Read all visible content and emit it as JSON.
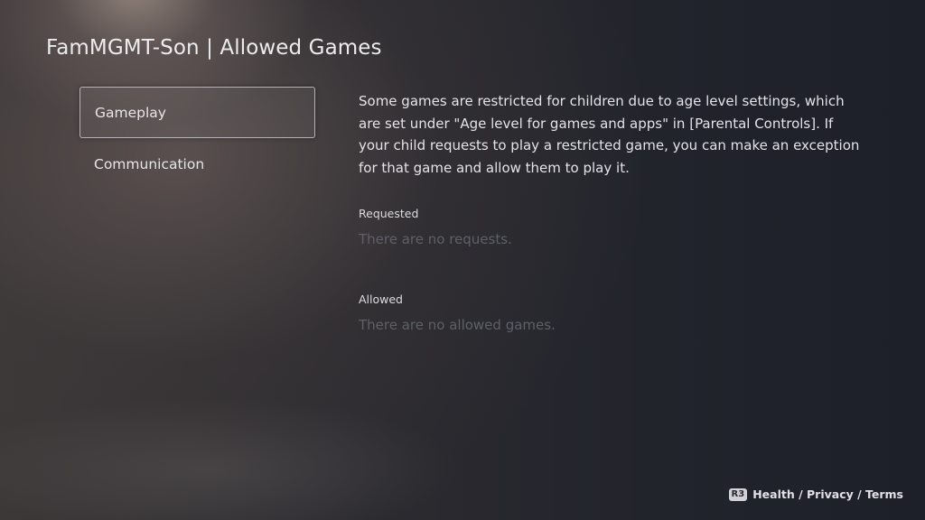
{
  "header": {
    "title": "FamMGMT-Son | Allowed Games"
  },
  "sidebar": {
    "items": [
      {
        "label": "Gameplay",
        "selected": true
      },
      {
        "label": "Communication",
        "selected": false
      }
    ]
  },
  "main": {
    "description": "Some games are restricted for children due to age level settings, which are set under \"Age level for games and apps\" in [Parental Controls]. If your child requests to play a restricted game, you can make an exception for that game and allow them to play it.",
    "requested": {
      "heading": "Requested",
      "empty_text": "There are no requests."
    },
    "allowed": {
      "heading": "Allowed",
      "empty_text": "There are no allowed games."
    }
  },
  "footer": {
    "button_glyph": "R3",
    "hint_label": "Health / Privacy / Terms"
  },
  "colors": {
    "background": "#22242c",
    "text_primary": "#e8e8ea",
    "text_disabled": "#5d6068",
    "selection_border": "#cdcdd4"
  },
  "icons": {
    "footer_button": "r3-button-icon"
  }
}
